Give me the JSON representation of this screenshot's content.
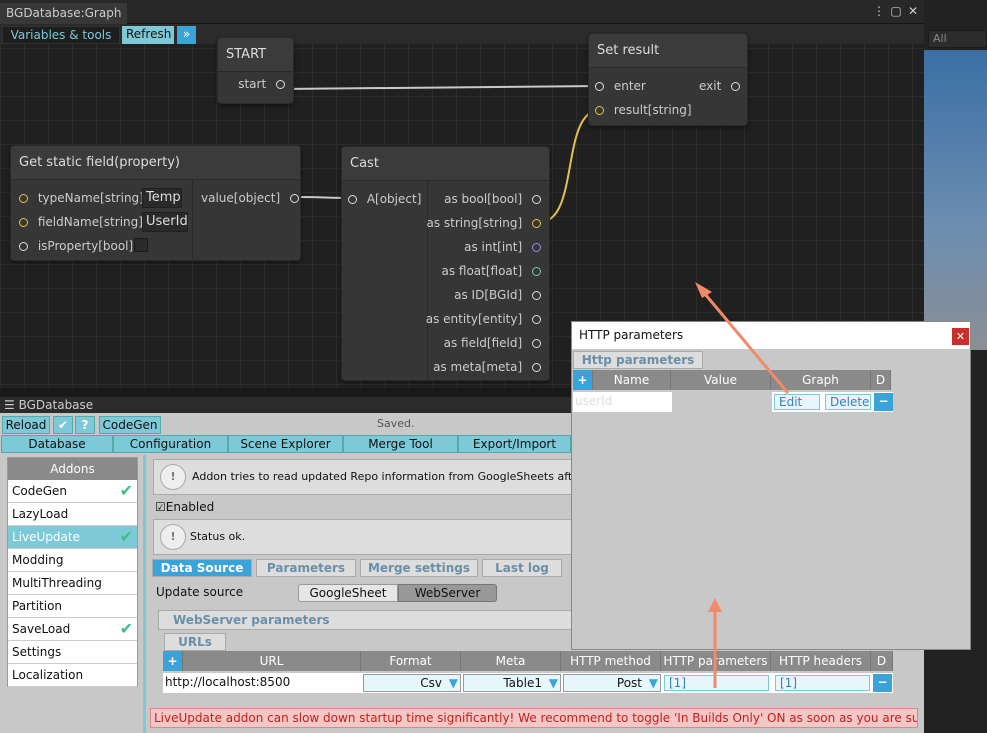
{
  "graph_window": {
    "title": "BGDatabase:Graph",
    "menu_icon": "more-vert-icon",
    "max_icon": "maximize-icon",
    "close_icon": "close-icon"
  },
  "graph_toolbar": {
    "variables": "Variables & tools",
    "refresh": "Refresh",
    "expand_icon": "double-chevron-icon"
  },
  "right_pane": {
    "search_placeholder": "All"
  },
  "nodes": {
    "start": {
      "title": "START",
      "port": "start"
    },
    "set_result": {
      "title": "Set result",
      "enter": "enter",
      "exit": "exit",
      "result": "result[string]"
    },
    "get_static": {
      "title": "Get static field(property)",
      "typeName": "typeName[string]",
      "typeName_val": "Temp",
      "fieldName": "fieldName[string]",
      "fieldName_val": "UserId",
      "isProperty": "isProperty[bool]",
      "value": "value[object]"
    },
    "cast": {
      "title": "Cast",
      "input": "A[object]",
      "outputs": [
        "as bool[bool]",
        "as string[string]",
        "as int[int]",
        "as float[float]",
        "as ID[BGId]",
        "as entity[entity]",
        "as field[field]",
        "as meta[meta]"
      ]
    }
  },
  "bgdb": {
    "title": "BGDatabase",
    "toolbar": {
      "reload": "Reload",
      "codegen": "CodeGen",
      "saved": "Saved."
    },
    "main_tabs": [
      "Database",
      "Configuration",
      "Scene Explorer",
      "Merge Tool",
      "Export/Import"
    ],
    "addons_header": "Addons",
    "addons": [
      {
        "label": "CodeGen",
        "checked": true
      },
      {
        "label": "LazyLoad",
        "checked": false
      },
      {
        "label": "LiveUpdate",
        "checked": true
      },
      {
        "label": "Modding",
        "checked": false
      },
      {
        "label": "MultiThreading",
        "checked": false
      },
      {
        "label": "Partition",
        "checked": false
      },
      {
        "label": "SaveLoad",
        "checked": true
      },
      {
        "label": "Settings",
        "checked": false
      },
      {
        "label": "Localization",
        "checked": false
      }
    ],
    "info": "Addon tries to read updated Repo information from GoogleSheets after repo is",
    "enabled": "Enabled",
    "status": "Status ok.",
    "sub_tabs": [
      "Data Source",
      "Parameters",
      "Merge settings",
      "Last log"
    ],
    "update_source_label": "Update source",
    "update_options": [
      "GoogleSheet",
      "WebServer"
    ],
    "webserver_params": "WebServer parameters",
    "urls_tab": "URLs",
    "url_headers": [
      "URL",
      "Format",
      "Meta",
      "HTTP method",
      "HTTP parameters",
      "HTTP headers",
      "D"
    ],
    "url_row": {
      "url": "http://localhost:8500",
      "format": "Csv",
      "meta": "Table1",
      "method": "Post",
      "params": "[1]",
      "headers": "[1]"
    },
    "warning": "LiveUpdate addon can slow down startup time significantly! We recommend to toggle 'In Builds Only' ON as soon as you are sure it works"
  },
  "http_dialog": {
    "title": "HTTP parameters",
    "tab": "Http parameters",
    "headers": [
      "Name",
      "Value",
      "Graph",
      "D"
    ],
    "row": {
      "name": "userId",
      "value": "",
      "edit": "Edit",
      "delete": "Delete"
    }
  }
}
